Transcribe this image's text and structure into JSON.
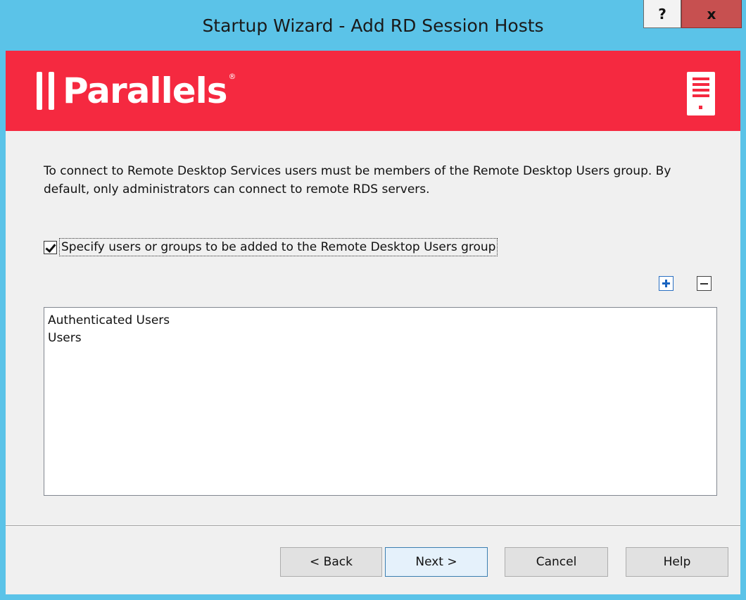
{
  "window": {
    "title": "Startup Wizard - Add RD Session Hosts",
    "help_label": "?",
    "close_label": "x"
  },
  "banner": {
    "brand": "Parallels",
    "registered": "®",
    "color": "#f52940"
  },
  "content": {
    "description": "To connect to Remote Desktop Services users must be members of the Remote Desktop Users group. By default, only administrators can connect to remote RDS servers.",
    "checkbox_label": "Specify users or groups to be added to the Remote Desktop Users group",
    "checkbox_checked": true,
    "list_items": [
      "Authenticated Users",
      "Users"
    ]
  },
  "buttons": {
    "back": "< Back",
    "next": "Next >",
    "cancel": "Cancel",
    "help": "Help"
  },
  "icons": {
    "add": "add-icon",
    "remove": "remove-icon",
    "server": "server-icon"
  }
}
